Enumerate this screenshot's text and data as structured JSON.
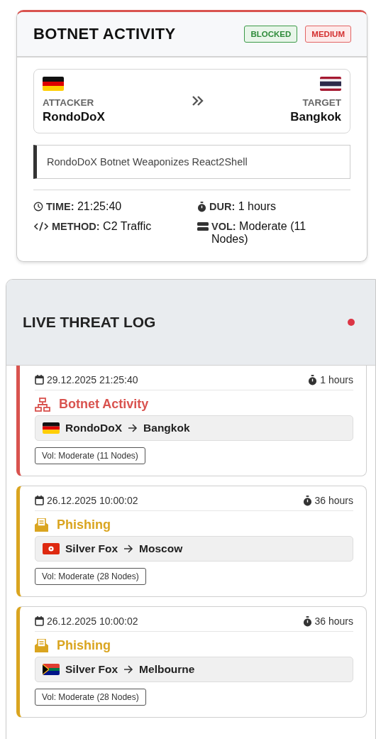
{
  "alert": {
    "title": "BOTNET ACTIVITY",
    "badges": [
      {
        "label": "BLOCKED",
        "kind": "status"
      },
      {
        "label": "MEDIUM",
        "kind": "severity"
      }
    ],
    "attacker": {
      "flag": {
        "kind": "de"
      },
      "caption": "ATTACKER",
      "name": "RondoDoX"
    },
    "target": {
      "flag": {
        "kind": "th"
      },
      "caption": "TARGET",
      "name": "Bangkok"
    },
    "description": "RondoDoX Botnet Weaponizes React2Shell",
    "details": [
      {
        "kind": "time",
        "label": "TIME:",
        "value": "21:25:40"
      },
      {
        "kind": "duration",
        "label": "DUR:",
        "value": "1 hours"
      },
      {
        "kind": "method",
        "label": "METHOD:",
        "value": "C2 Traffic"
      },
      {
        "kind": "volume",
        "label": "VOL:",
        "value": "Moderate (11 Nodes)"
      }
    ]
  },
  "log": {
    "title": "LIVE THREAT LOG",
    "live": true,
    "entries": [
      {
        "kind": "botnet",
        "date": "29.12.2025 21:25:40",
        "duration": "1 hours",
        "title": "Botnet Activity",
        "flag": {
          "kind": "de"
        },
        "source": "RondoDoX",
        "target": "Bangkok",
        "volume": "Vol: Moderate (11 Nodes)"
      },
      {
        "kind": "phishing",
        "date": "26.12.2025 10:00:02",
        "duration": "36 hours",
        "title": "Phishing",
        "flag": {
          "kind": "hk"
        },
        "source": "Silver Fox",
        "target": "Moscow",
        "volume": "Vol: Moderate (28 Nodes)"
      },
      {
        "kind": "phishing",
        "date": "26.12.2025 10:00:02",
        "duration": "36 hours",
        "title": "Phishing",
        "flag": {
          "kind": "za"
        },
        "source": "Silver Fox",
        "target": "Melbourne",
        "volume": "Vol: Moderate (28 Nodes)"
      }
    ]
  }
}
